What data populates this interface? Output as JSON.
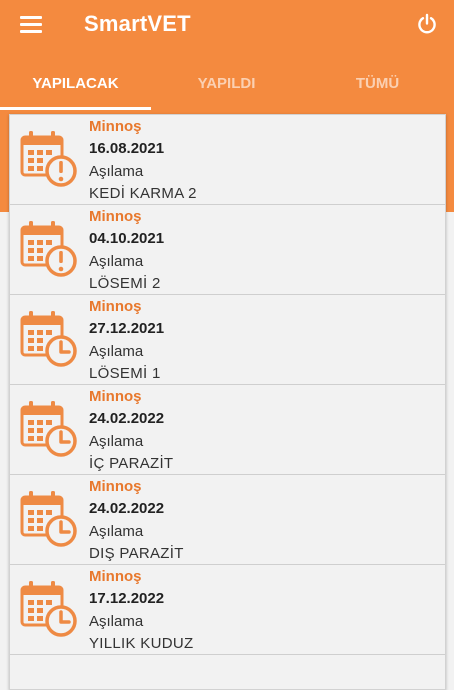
{
  "app": {
    "title": "SmartVET"
  },
  "toolbar": {
    "menu_icon": "hamburger-menu-icon",
    "power_icon": "power-icon"
  },
  "tabs": [
    {
      "label": "YAPILACAK",
      "active": true
    },
    {
      "label": "YAPILDI",
      "active": false
    },
    {
      "label": "TÜMÜ",
      "active": false
    }
  ],
  "colors": {
    "accent": "#f48a3f",
    "pet_name": "#e8782c",
    "icon": "#ee8a44"
  },
  "items": [
    {
      "pet": "Minnoş",
      "date": "16.08.2021",
      "type": "Aşılama",
      "name": "KEDİ KARMA 2",
      "icon": "calendar-alert-icon"
    },
    {
      "pet": "Minnoş",
      "date": "04.10.2021",
      "type": "Aşılama",
      "name": "LÖSEMİ  2",
      "icon": "calendar-alert-icon"
    },
    {
      "pet": "Minnoş",
      "date": "27.12.2021",
      "type": "Aşılama",
      "name": "LÖSEMİ  1",
      "icon": "calendar-clock-icon"
    },
    {
      "pet": "Minnoş",
      "date": "24.02.2022",
      "type": "Aşılama",
      "name": "İÇ PARAZİT",
      "icon": "calendar-clock-icon"
    },
    {
      "pet": "Minnoş",
      "date": "24.02.2022",
      "type": "Aşılama",
      "name": "DIŞ PARAZİT",
      "icon": "calendar-clock-icon"
    },
    {
      "pet": "Minnoş",
      "date": "17.12.2022",
      "type": "Aşılama",
      "name": "YILLIK KUDUZ",
      "icon": "calendar-clock-icon"
    }
  ]
}
